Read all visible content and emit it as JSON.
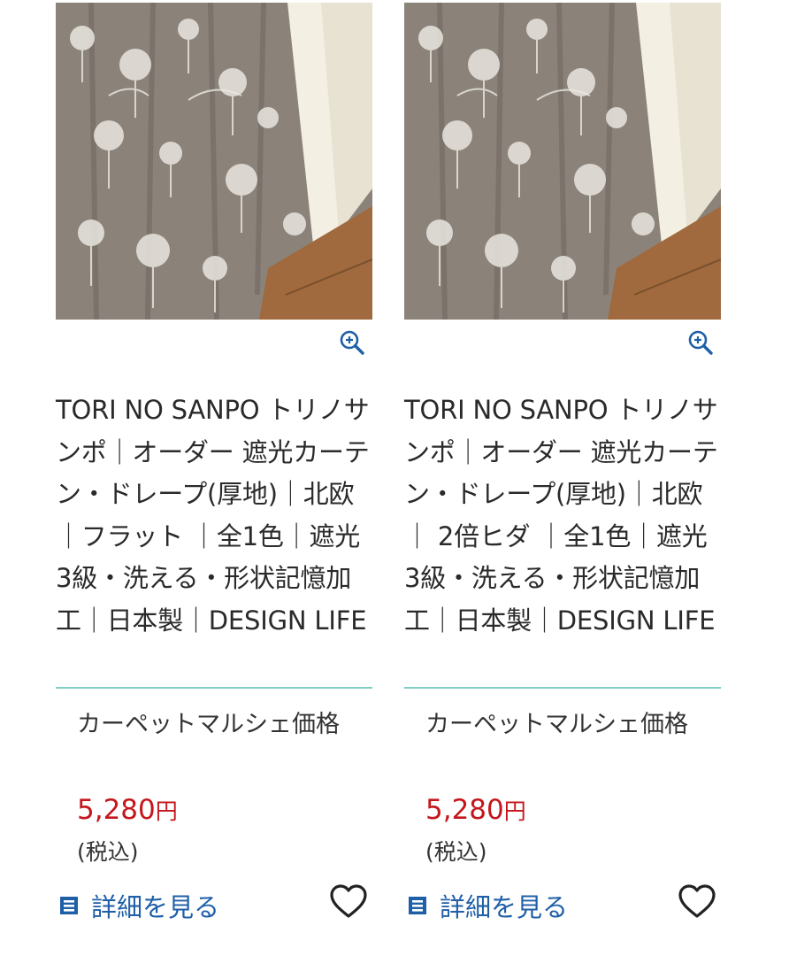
{
  "products": [
    {
      "title": "TORI NO SANPO トリノサンポ｜オーダー 遮光カーテン・ドレープ(厚地)｜北欧｜フラット ｜全1色｜遮光3級・洗える・形状記憶加工｜日本製｜DESIGN LIFE",
      "price_label": "カーペットマルシェ価格",
      "price": "5,280",
      "currency": "円",
      "tax_note": "(税込)",
      "detail_label": "詳細を見る",
      "icons": {
        "zoom": "zoom-in-icon",
        "detail": "document-icon",
        "favorite": "heart-icon"
      }
    },
    {
      "title": "TORI NO SANPO トリノサンポ｜オーダー 遮光カーテン・ドレープ(厚地)｜北欧｜ 2倍ヒダ ｜全1色｜遮光3級・洗える・形状記憶加工｜日本製｜DESIGN LIFE",
      "price_label": "カーペットマルシェ価格",
      "price": "5,280",
      "currency": "円",
      "tax_note": "(税込)",
      "detail_label": "詳細を見る",
      "icons": {
        "zoom": "zoom-in-icon",
        "detail": "document-icon",
        "favorite": "heart-icon"
      }
    }
  ],
  "colors": {
    "price": "#c4161c",
    "link": "#1f5fa8",
    "divider": "#7fcfc6",
    "zoom_icon": "#1f5fa8"
  }
}
